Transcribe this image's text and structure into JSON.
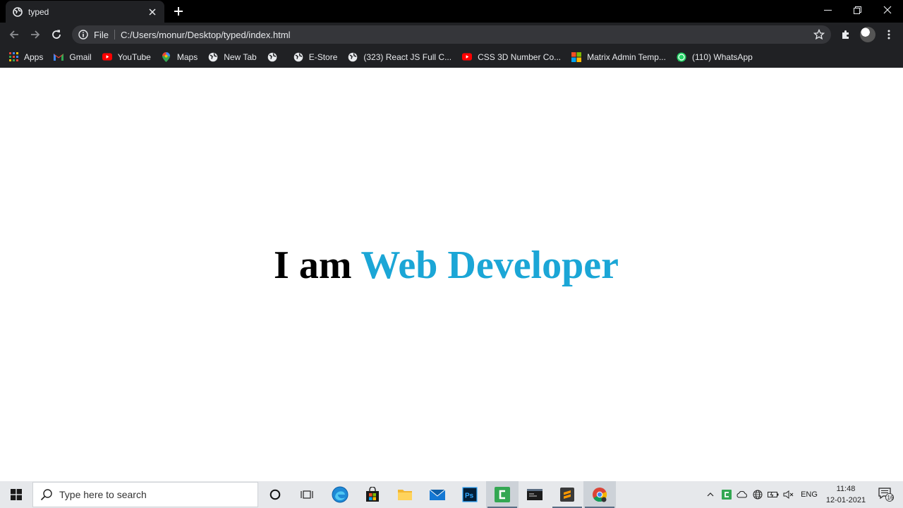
{
  "browser": {
    "tab_title": "typed",
    "address_scheme": "File",
    "address_url": "C:/Users/monur/Desktop/typed/index.html",
    "bookmarks": [
      {
        "label": "Apps",
        "icon": "apps-grid-icon"
      },
      {
        "label": "Gmail",
        "icon": "gmail-icon"
      },
      {
        "label": "YouTube",
        "icon": "youtube-icon"
      },
      {
        "label": "Maps",
        "icon": "maps-icon"
      },
      {
        "label": "New Tab",
        "icon": "globe-icon"
      },
      {
        "label": "",
        "icon": "globe-icon"
      },
      {
        "label": "E-Store",
        "icon": "globe-icon"
      },
      {
        "label": "(323) React JS Full C...",
        "icon": "globe-icon"
      },
      {
        "label": "CSS 3D Number Co...",
        "icon": "youtube-icon"
      },
      {
        "label": "Matrix Admin Temp...",
        "icon": "microsoft-icon"
      },
      {
        "label": "(110) WhatsApp",
        "icon": "whatsapp-icon"
      }
    ],
    "colors": {
      "tabbar": "#000000",
      "chrome": "#202124",
      "omnibox": "#35363a"
    }
  },
  "page": {
    "static_text": "I am",
    "typed_text": "Web Developer",
    "typed_color": "#1ba6d6"
  },
  "taskbar": {
    "search_placeholder": "Type here to search",
    "language": "ENG",
    "time": "11:48",
    "date": "12-01-2021",
    "notification_count": "16"
  }
}
